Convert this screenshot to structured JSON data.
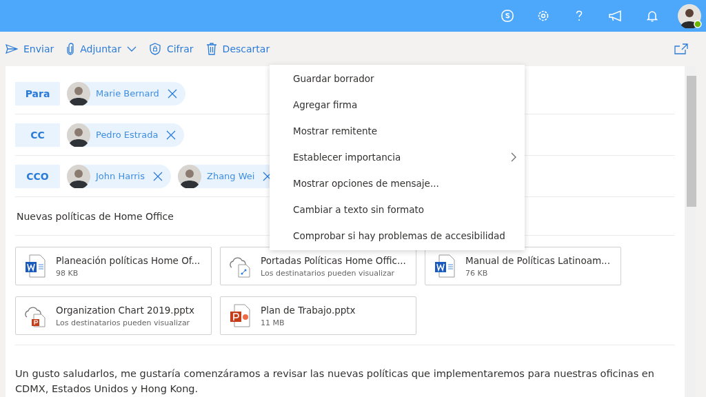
{
  "toolbar": {
    "actions": [
      {
        "kind": "send",
        "label": "Enviar",
        "dropdown": false
      },
      {
        "kind": "attach",
        "label": "Adjuntar",
        "dropdown": true
      },
      {
        "kind": "encrypt",
        "label": "Cifrar",
        "dropdown": false
      },
      {
        "kind": "discard",
        "label": "Descartar",
        "dropdown": false
      }
    ]
  },
  "recipients": [
    {
      "label": "Para",
      "people": [
        "Marie Bernard"
      ]
    },
    {
      "label": "CC",
      "people": [
        "Pedro Estrada"
      ]
    },
    {
      "label": "CCO",
      "people": [
        "John Harris",
        "Zhang Wei"
      ]
    }
  ],
  "subject": "Nuevas políticas de Home Office",
  "attachments": [
    {
      "kind": "word",
      "name": "Planeación políticas Home Of...",
      "detail": "98 KB"
    },
    {
      "kind": "cloud-file",
      "name": "Portadas Políticas Home Offic...",
      "detail": "Los destinatarios pueden visualizar"
    },
    {
      "kind": "word",
      "name": "Manual de Políticas Latinoam...",
      "detail": "76 KB"
    },
    {
      "kind": "cloud-ppt",
      "name": "Organization Chart 2019.pptx",
      "detail": "Los destinatarios pueden visualizar"
    },
    {
      "kind": "ppt",
      "name": "Plan de Trabajo.pptx",
      "detail": "11 MB"
    }
  ],
  "body": "Un gusto saludarlos, me gustaría comenzáramos a revisar las nuevas políticas que implementaremos para nuestras oficinas en CDMX, Estados Unidos y Hong Kong.",
  "menu": {
    "items": [
      {
        "label": "Guardar borrador",
        "submenu": false
      },
      {
        "label": "Agregar firma",
        "submenu": false
      },
      {
        "label": "Mostrar remitente",
        "submenu": false
      },
      {
        "label": "Establecer importancia",
        "submenu": true
      },
      {
        "label": "Mostrar opciones de mensaje...",
        "submenu": false
      },
      {
        "label": "Cambiar a texto sin formato",
        "submenu": false
      },
      {
        "label": "Comprobar si hay problemas de accesibilidad",
        "submenu": false
      }
    ]
  }
}
